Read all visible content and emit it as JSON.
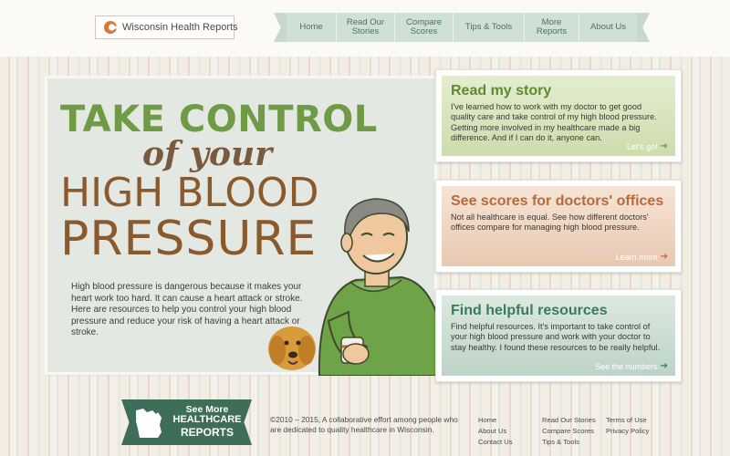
{
  "header": {
    "logo_text": "Wisconsin Health Reports",
    "nav": [
      {
        "label_line1": "Home",
        "label_line2": ""
      },
      {
        "label_line1": "Read Our",
        "label_line2": "Stories"
      },
      {
        "label_line1": "Compare",
        "label_line2": "Scores"
      },
      {
        "label_line1": "Tips & Tools",
        "label_line2": ""
      },
      {
        "label_line1": "More",
        "label_line2": "Reports"
      },
      {
        "label_line1": "About Us",
        "label_line2": ""
      }
    ]
  },
  "hero": {
    "line1": "TAKE CONTROL",
    "line2": "of your",
    "line3": "HIGH BLOOD",
    "line4": "PRESSURE",
    "body": "High blood pressure is dangerous because it makes your heart work too hard. It can cause a heart attack or stroke. Here are resources to help you control your high blood pressure and reduce your risk of having a heart attack or stroke."
  },
  "cards": [
    {
      "title": "Read my story",
      "text": "I've learned how to work with my doctor to get good quality care and take control of my high blood pressure. Getting more involved in my healthcare made a big difference. And if I can do it, anyone can.",
      "link": "Let's go!"
    },
    {
      "title": "See scores for doctors' offices",
      "text": "Not all healthcare is equal. See how different doctors' offices compare for managing high blood pressure.",
      "link": "Learn more"
    },
    {
      "title": "Find helpful resources",
      "text": "Find helpful resources. It's important to take control of your high blood pressure and work with your doctor to stay healthy. I found these resources to be really helpful.",
      "link": "See the numbers"
    }
  ],
  "footer": {
    "see_more_1": "See More",
    "see_more_2": "HEALTHCARE",
    "see_more_3": "REPORTS",
    "copyright": "©2010 – 2015, A collaborative effort among people who are dedicated to quality healthcare in Wisconsin.",
    "col1": [
      "Home",
      "About Us",
      "Contact Us"
    ],
    "col2": [
      "Read Our Stories",
      "Compare Scores",
      "Tips & Tools"
    ],
    "col3": [
      "Terms of Use",
      "Privacy Policy"
    ]
  },
  "colors": {
    "accent_green": "#6f9a46",
    "accent_brown": "#8a5a2c",
    "accent_orange": "#b86a3a",
    "accent_teal": "#3e6e59"
  }
}
